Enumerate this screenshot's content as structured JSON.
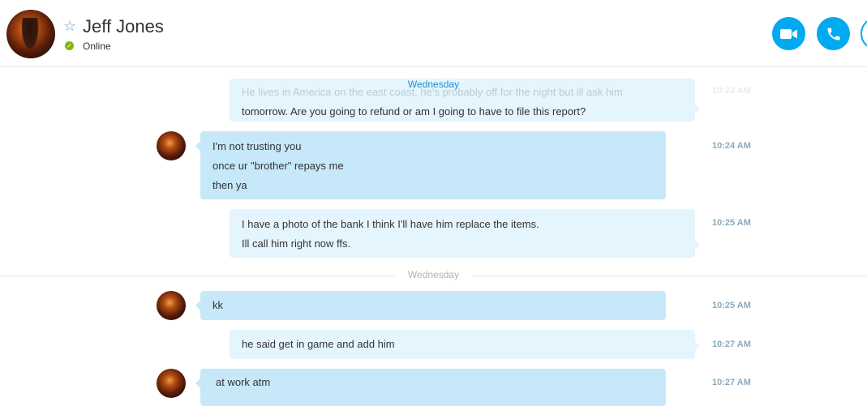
{
  "header": {
    "name": "Jeff Jones",
    "status": "Online",
    "star_glyph": "☆",
    "video_icon": "video-icon",
    "call_icon": "phone-icon",
    "accent": "#00a9f0",
    "status_color": "#7fba00"
  },
  "chat": {
    "day_top": "Wednesday",
    "day_divider": "Wednesday",
    "messages": [
      {
        "lines": [
          "He lives in America on the east coast, he's probably off for the night but ill ask him",
          "tomorrow. Are you going to refund or am I going to have to file this report?"
        ],
        "time": "10:23 AM"
      },
      {
        "lines": [
          "I'm not trusting you",
          "once ur \"brother\" repays me",
          "then ya"
        ],
        "time": "10:24 AM"
      },
      {
        "lines": [
          "I have a photo of the bank I think I'll have him replace the items.",
          "Ill call him right now ffs."
        ],
        "time": "10:25 AM"
      },
      {
        "lines": [
          "kk"
        ],
        "time": "10:25 AM"
      },
      {
        "lines": [
          "he said get in game and add him"
        ],
        "time": "10:27 AM"
      },
      {
        "lines": [
          "at work atm"
        ],
        "time": "10:27 AM"
      }
    ]
  }
}
